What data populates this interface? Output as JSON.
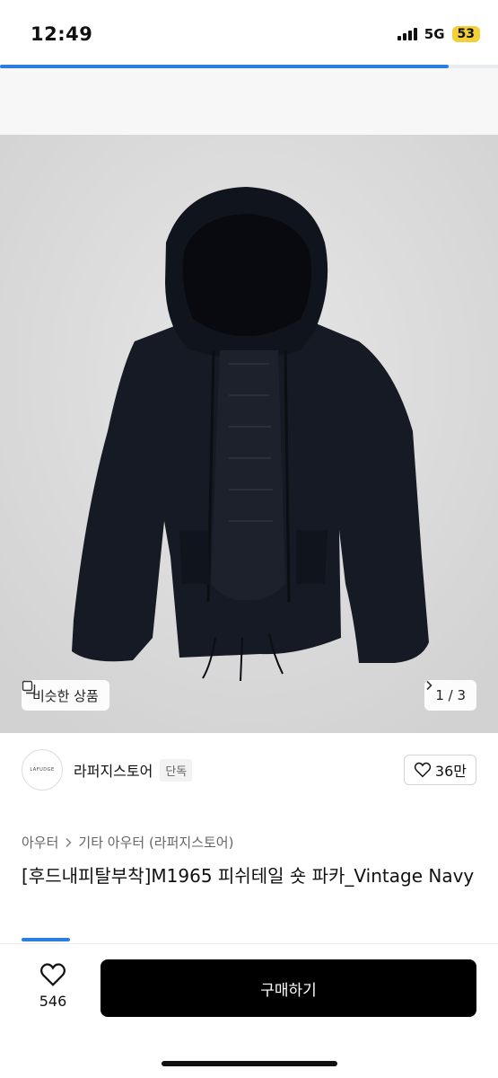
{
  "status_bar": {
    "time": "12:49",
    "network": "5G",
    "battery": "53"
  },
  "page_progress": 0.9,
  "hero": {
    "similar_label": "비슷한 상품",
    "page_indicator": "1 / 3",
    "background_color": "#dcdcdc",
    "jacket_color": "#151a24"
  },
  "store": {
    "logo_text": "LAFUDGE",
    "name": "라퍼지스토어",
    "badge": "단독",
    "likes": "36만"
  },
  "breadcrumb": [
    "아우터",
    "기타 아우터 (라퍼지스토어)"
  ],
  "product_title": "[후드내피탈부착]M1965 피쉬테일 숏 파카_Vintage Navy",
  "bottom_bar": {
    "like_count": "546",
    "buy_label": "구매하기"
  },
  "colors": {
    "accent": "#2a7de1",
    "buy_button": "#000000"
  }
}
